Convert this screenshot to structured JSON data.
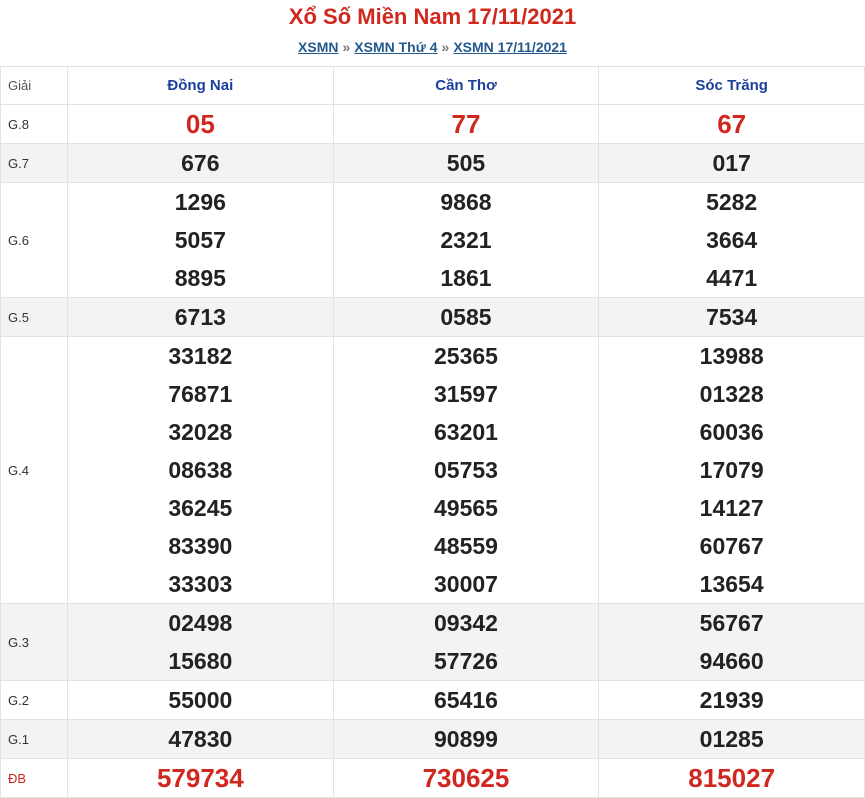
{
  "header": {
    "title": "Xổ Số Miền Nam 17/11/2021",
    "breadcrumb": [
      "XSMN",
      "XSMN Thứ 4",
      "XSMN 17/11/2021"
    ],
    "separator": "»"
  },
  "table": {
    "columns": [
      "Giải",
      "Đồng Nai",
      "Cần Thơ",
      "Sóc Trăng"
    ],
    "rows": [
      {
        "label": "G.8",
        "values": [
          [
            "05"
          ],
          [
            "77"
          ],
          [
            "67"
          ]
        ]
      },
      {
        "label": "G.7",
        "values": [
          [
            "676"
          ],
          [
            "505"
          ],
          [
            "017"
          ]
        ]
      },
      {
        "label": "G.6",
        "values": [
          [
            "1296",
            "5057",
            "8895"
          ],
          [
            "9868",
            "2321",
            "1861"
          ],
          [
            "5282",
            "3664",
            "4471"
          ]
        ]
      },
      {
        "label": "G.5",
        "values": [
          [
            "6713"
          ],
          [
            "0585"
          ],
          [
            "7534"
          ]
        ]
      },
      {
        "label": "G.4",
        "values": [
          [
            "33182",
            "76871",
            "32028",
            "08638",
            "36245",
            "83390",
            "33303"
          ],
          [
            "25365",
            "31597",
            "63201",
            "05753",
            "49565",
            "48559",
            "30007"
          ],
          [
            "13988",
            "01328",
            "60036",
            "17079",
            "14127",
            "60767",
            "13654"
          ]
        ]
      },
      {
        "label": "G.3",
        "values": [
          [
            "02498",
            "15680"
          ],
          [
            "09342",
            "57726"
          ],
          [
            "56767",
            "94660"
          ]
        ]
      },
      {
        "label": "G.2",
        "values": [
          [
            "55000"
          ],
          [
            "65416"
          ],
          [
            "21939"
          ]
        ]
      },
      {
        "label": "G.1",
        "values": [
          [
            "47830"
          ],
          [
            "90899"
          ],
          [
            "01285"
          ]
        ]
      },
      {
        "label": "ĐB",
        "values": [
          [
            "579734"
          ],
          [
            "730625"
          ],
          [
            "815027"
          ]
        ]
      }
    ]
  },
  "colors": {
    "title": "#d0281f",
    "province": "#1a3f9c",
    "link": "#24598e",
    "highlight": "#d0281f"
  }
}
